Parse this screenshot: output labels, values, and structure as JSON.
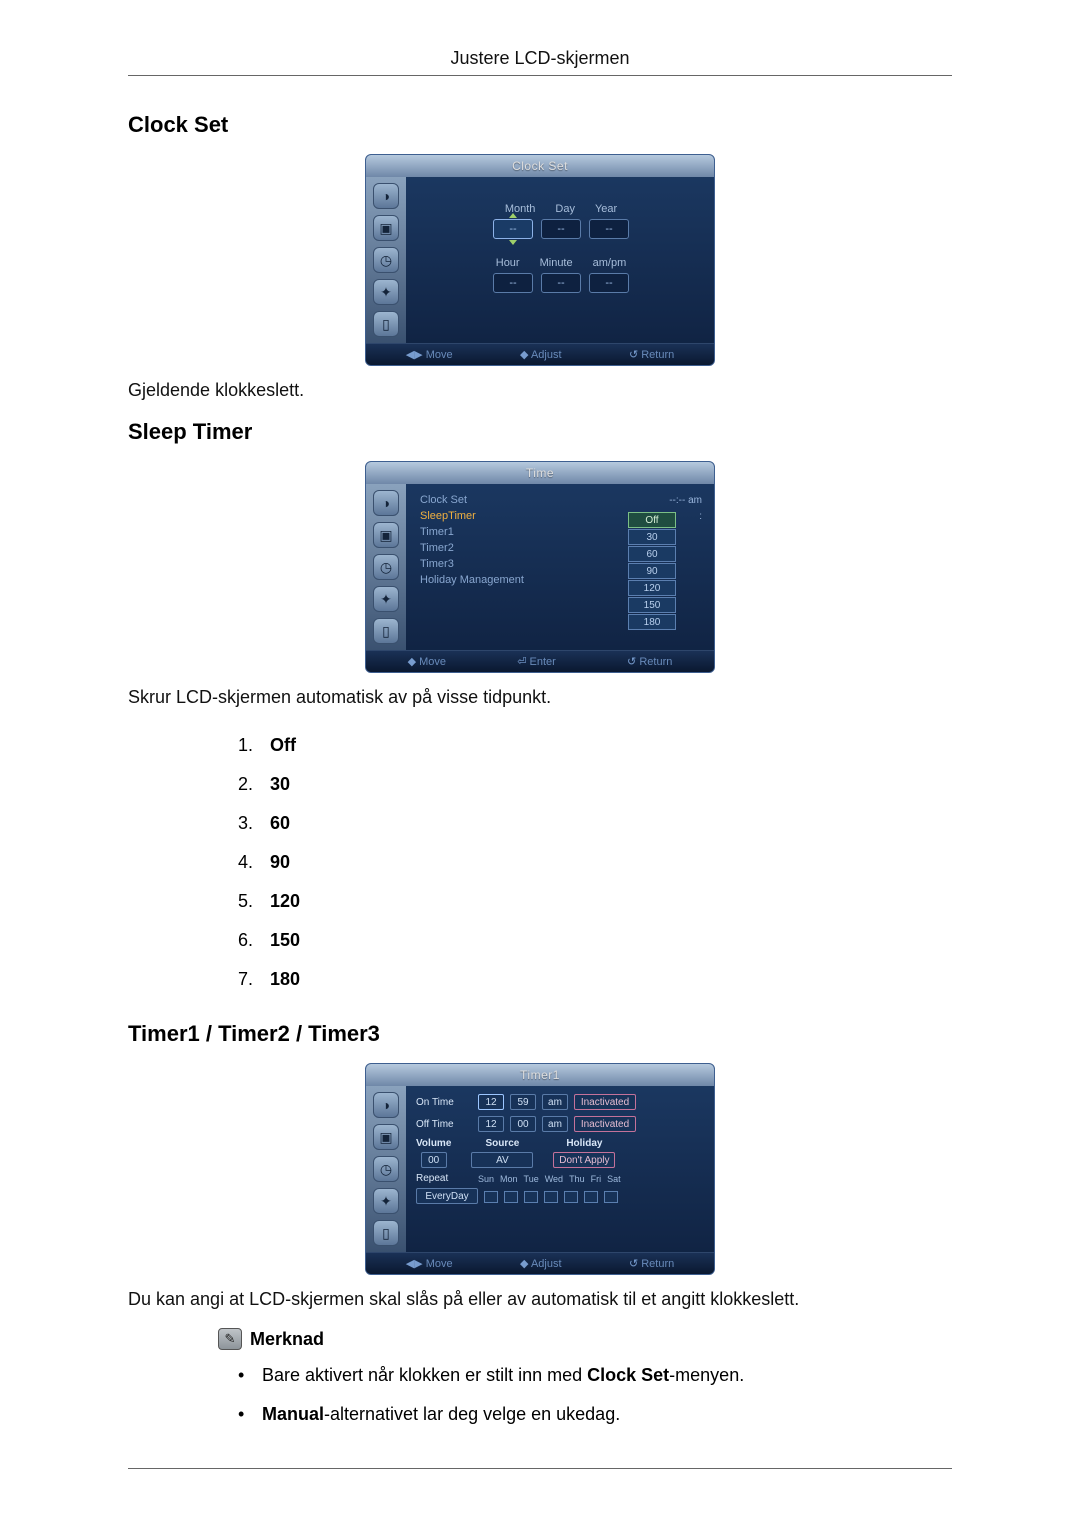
{
  "header": {
    "title": "Justere LCD-skjermen"
  },
  "section_clock": {
    "heading": "Clock Set",
    "caption": "Gjeldende klokkeslett.",
    "osd": {
      "title": "Clock Set",
      "labels_top": [
        "Month",
        "Day",
        "Year"
      ],
      "labels_bottom": [
        "Hour",
        "Minute",
        "am/pm"
      ],
      "field_placeholder": "--",
      "footer": {
        "move": "Move",
        "adjust": "Adjust",
        "ret": "Return"
      }
    }
  },
  "section_sleep": {
    "heading": "Sleep Timer",
    "caption": "Skrur LCD-skjermen automatisk av på visse tidpunkt.",
    "options_label_list": [
      {
        "n": 1,
        "val": "Off"
      },
      {
        "n": 2,
        "val": "30"
      },
      {
        "n": 3,
        "val": "60"
      },
      {
        "n": 4,
        "val": "90"
      },
      {
        "n": 5,
        "val": "120"
      },
      {
        "n": 6,
        "val": "150"
      },
      {
        "n": 7,
        "val": "180"
      }
    ],
    "osd": {
      "title": "Time",
      "rows": [
        {
          "label": "Clock Set",
          "value": "--:-- am",
          "active": false
        },
        {
          "label": "SleepTimer",
          "value": ":",
          "active": true
        },
        {
          "label": "Timer1",
          "value": "",
          "active": false
        },
        {
          "label": "Timer2",
          "value": "",
          "active": false
        },
        {
          "label": "Timer3",
          "value": "",
          "active": false
        },
        {
          "label": "Holiday Management",
          "value": "",
          "active": false
        }
      ],
      "options": [
        "Off",
        "30",
        "60",
        "90",
        "120",
        "150",
        "180"
      ],
      "footer": {
        "move": "Move",
        "enter": "Enter",
        "ret": "Return"
      }
    }
  },
  "section_timer": {
    "heading": "Timer1 / Timer2 / Timer3",
    "caption": "Du kan angi at LCD-skjermen skal slås på eller av automatisk til et angitt klokkeslett.",
    "note_label": "Merknad",
    "bullets": [
      {
        "pre": "Bare aktivert når klokken er stilt inn med ",
        "bold": "Clock Set",
        "post": "-menyen."
      },
      {
        "pre": "",
        "bold": "Manual",
        "post": "-alternativet lar deg velge en ukedag."
      }
    ],
    "osd": {
      "title": "Timer1",
      "on": {
        "label": "On Time",
        "h": "12",
        "m": "59",
        "ap": "am",
        "state": "Inactivated"
      },
      "off": {
        "label": "Off Time",
        "h": "12",
        "m": "00",
        "ap": "am",
        "state": "Inactivated"
      },
      "cols": {
        "volume": {
          "head": "Volume",
          "val": "00"
        },
        "source": {
          "head": "Source",
          "val": "AV"
        },
        "holiday": {
          "head": "Holiday",
          "val": "Don't Apply"
        }
      },
      "repeat": {
        "label": "Repeat",
        "val": "EveryDay"
      },
      "days": [
        "Sun",
        "Mon",
        "Tue",
        "Wed",
        "Thu",
        "Fri",
        "Sat"
      ],
      "footer": {
        "move": "Move",
        "adjust": "Adjust",
        "ret": "Return"
      }
    }
  }
}
